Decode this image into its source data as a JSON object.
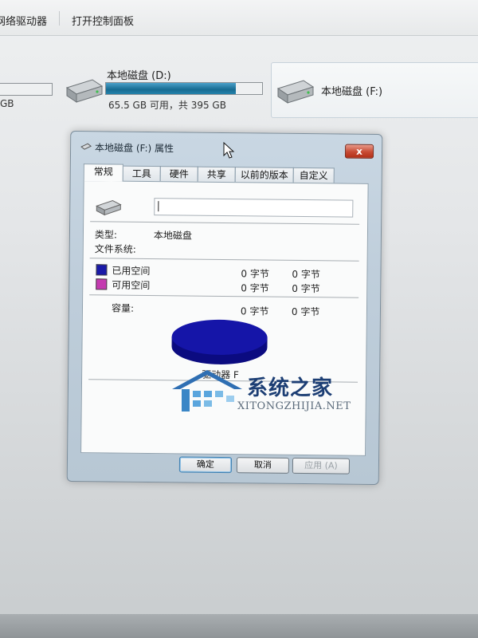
{
  "toolbar": {
    "network_drive_label": "网络驱动器",
    "control_panel_label": "打开控制面板"
  },
  "drives": {
    "left_partial": {
      "info": "GB"
    },
    "d": {
      "name": "本地磁盘 (D:)",
      "info": "65.5 GB 可用，共 395 GB",
      "used_fraction": 0.83
    },
    "f": {
      "name": "本地磁盘 (F:)"
    }
  },
  "dialog": {
    "title": "本地磁盘 (F:) 属性",
    "close_label": "x",
    "tabs": [
      "常规",
      "工具",
      "硬件",
      "共享",
      "以前的版本",
      "自定义"
    ],
    "active_tab": 0,
    "type_label": "类型:",
    "type_value": "本地磁盘",
    "fs_label": "文件系统:",
    "used_label": "已用空间",
    "used_bytes": "0 字节",
    "used_size": "0 字节",
    "free_label": "可用空间",
    "free_bytes": "0 字节",
    "free_size": "0 字节",
    "capacity_label": "容量:",
    "capacity_bytes": "0 字节",
    "capacity_size": "0 字节",
    "drive_label": "驱动器 F",
    "ok_label": "确定",
    "cancel_label": "取消",
    "apply_label": "应用 (A)"
  },
  "colors": {
    "used": "#1a1aa8",
    "free": "#c43ab0",
    "pie": "#1515a8"
  },
  "watermark": {
    "title": "系统之家",
    "subtitle": "XITONGZHIJIA.NET"
  }
}
